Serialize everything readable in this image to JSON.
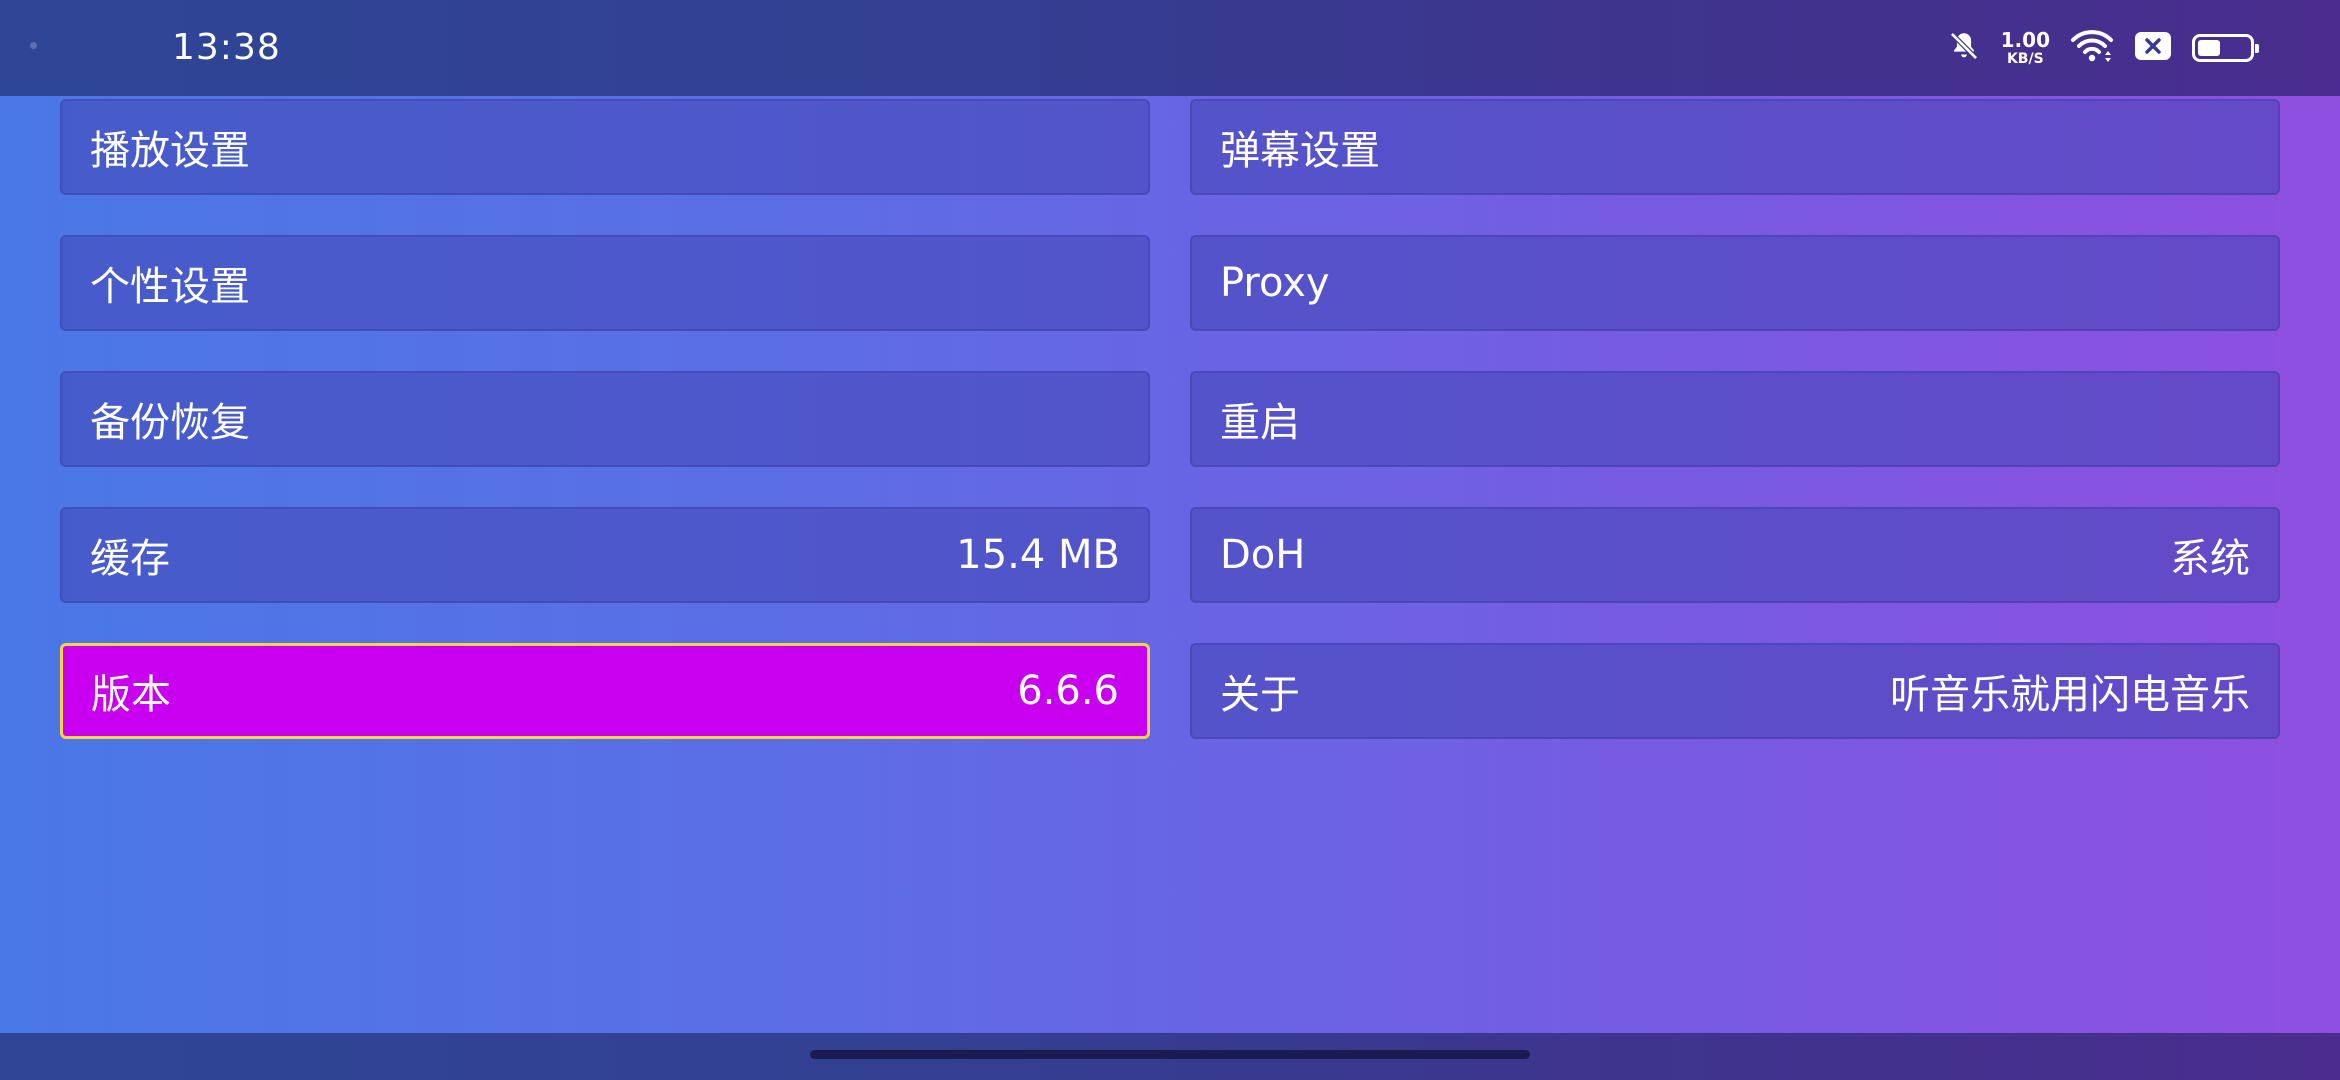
{
  "status_bar": {
    "time": "13:38",
    "net_speed_value": "1.00",
    "net_speed_unit": "KB/S",
    "icons": [
      "notifications-muted-icon",
      "wifi-icon",
      "no-sim-icon",
      "battery-icon"
    ],
    "battery_level": 0.5
  },
  "settings": {
    "left": [
      {
        "label": "播放设置",
        "value": ""
      },
      {
        "label": "个性设置",
        "value": ""
      },
      {
        "label": "备份恢复",
        "value": ""
      },
      {
        "label": "缓存",
        "value": "15.4 MB"
      },
      {
        "label": "版本",
        "value": "6.6.6"
      }
    ],
    "right": [
      {
        "label": "弹幕设置",
        "value": ""
      },
      {
        "label": "Proxy",
        "value": ""
      },
      {
        "label": "重启",
        "value": ""
      },
      {
        "label": "DoH",
        "value": "系统"
      },
      {
        "label": "关于",
        "value": "听音乐就用闪电音乐"
      }
    ]
  },
  "colors": {
    "focus_background": "#c800ef",
    "focus_border": "#f5d547"
  }
}
